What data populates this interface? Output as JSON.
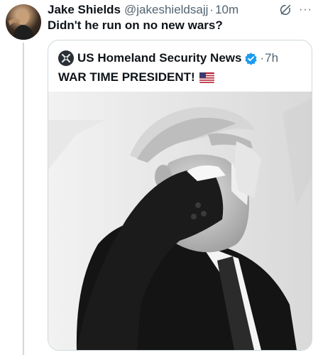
{
  "tweet": {
    "author_name": "Jake Shields",
    "author_handle": "@jakeshieldsajj",
    "separator": "·",
    "time": "10m",
    "text": "Didn't he run on no new wars?",
    "avatar_icon": "profile-avatar",
    "actions": {
      "grok_icon": "grok-icon",
      "more_label": "···"
    }
  },
  "quote": {
    "author_name": "US Homeland Security News",
    "separator": "·",
    "time": "7h",
    "verified_icon": "verified-badge-icon",
    "verified_color": "#1d9bf0",
    "text": "WAR TIME PRESIDENT!",
    "flag_icon": "us-flag-icon"
  },
  "colors": {
    "text": "#0f1419",
    "secondary": "#536471",
    "border": "#cfd9de",
    "accent": "#1d9bf0"
  }
}
